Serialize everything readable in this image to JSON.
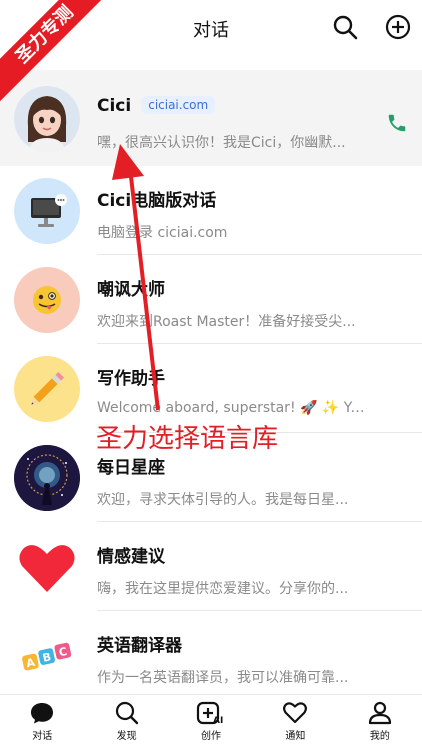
{
  "header": {
    "title": "对话"
  },
  "ribbon": {
    "text": "圣力专测"
  },
  "chats": [
    {
      "name": "Cici",
      "badge": "ciciai.com",
      "preview": "嘿，很高兴认识你！我是Cici，你幽默..."
    },
    {
      "name": "Cici电脑版对话",
      "preview": "电脑登录 ciciai.com"
    },
    {
      "name": "嘲讽大师",
      "preview": "欢迎来到Roast Master！准备好接受尖..."
    },
    {
      "name": "写作助手",
      "preview": "Welcome aboard, superstar! 🚀 ✨ You..."
    },
    {
      "name": "每日星座",
      "preview": "欢迎，寻求天体引导的人。我是每日星..."
    },
    {
      "name": "情感建议",
      "preview": "嗨，我在这里提供恋爱建议。分享你的..."
    },
    {
      "name": "英语翻译器",
      "preview": "作为一名英语翻译员，我可以准确可靠..."
    }
  ],
  "annotation": {
    "text": "圣力选择语言库"
  },
  "tabs": [
    {
      "label": "对话"
    },
    {
      "label": "发现"
    },
    {
      "label": "创作"
    },
    {
      "label": "通知"
    },
    {
      "label": "我的"
    }
  ],
  "colors": {
    "accent": "#e31e24",
    "phone": "#22a06b",
    "badge_bg": "#e6f0ff",
    "badge_text": "#3a6fd8"
  },
  "icons": [
    "search-icon",
    "plus-circle-icon",
    "phone-icon",
    "chat-bubble-icon",
    "discover-search-icon",
    "ai-create-icon",
    "heart-icon",
    "profile-icon"
  ]
}
